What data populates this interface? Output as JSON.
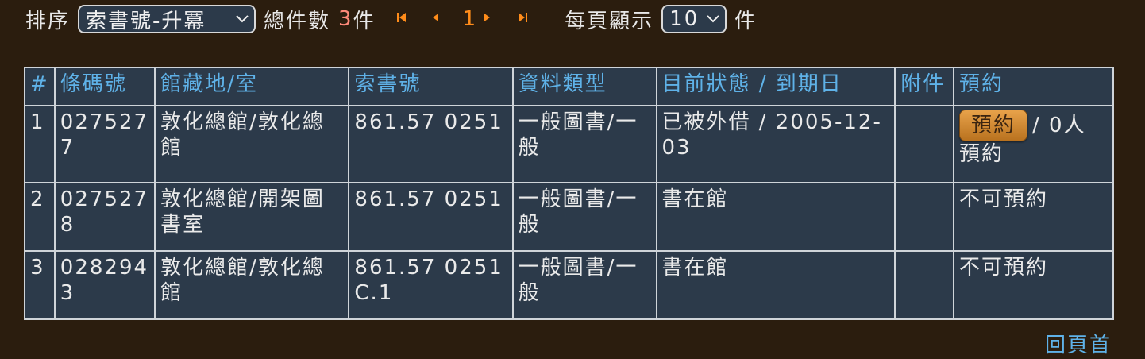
{
  "toolbar": {
    "sort_label": "排序",
    "sort_value": "索書號-升冪",
    "total_label": "總件數",
    "total_count": "3",
    "total_unit": "件",
    "current_page": "1",
    "page_size_label": "每頁顯示",
    "page_size_value": "10",
    "page_size_unit": "件"
  },
  "table": {
    "headers": [
      "#",
      "條碼號",
      "館藏地/室",
      "索書號",
      "資料類型",
      "目前狀態 / 到期日",
      "附件",
      "預約"
    ],
    "rows": [
      {
        "index": "1",
        "barcode": "0275277",
        "location": "敦化總館/敦化總館",
        "call_number": "861.57 0251",
        "material_type": "一般圖書/一般",
        "status": "已被外借 / 2005-12-03",
        "attachment": "",
        "reserve_button": "預約",
        "reserve_text": "/ 0人預約"
      },
      {
        "index": "2",
        "barcode": "0275278",
        "location": "敦化總館/開架圖書室",
        "call_number": "861.57 0251",
        "material_type": "一般圖書/一般",
        "status": "書在館",
        "attachment": "",
        "reserve_text": "不可預約"
      },
      {
        "index": "3",
        "barcode": "0282943",
        "location": "敦化總館/敦化總館",
        "call_number": "861.57 0251 C.1",
        "material_type": "一般圖書/一般",
        "status": "書在館",
        "attachment": "",
        "reserve_text": "不可預約"
      }
    ]
  },
  "footer": {
    "back_to_top": "回頁首"
  },
  "icons": {
    "first": "first-page-icon",
    "prev": "prev-page-icon",
    "next": "next-page-icon",
    "last": "last-page-icon",
    "dropdown": "chevron-down-icon"
  },
  "colors": {
    "background": "#2b1d0e",
    "table_bg": "#2c3a4a",
    "header_text": "#5fb2e8",
    "count_text": "#ff8a7a",
    "pager_accent": "#ff8c1a"
  }
}
